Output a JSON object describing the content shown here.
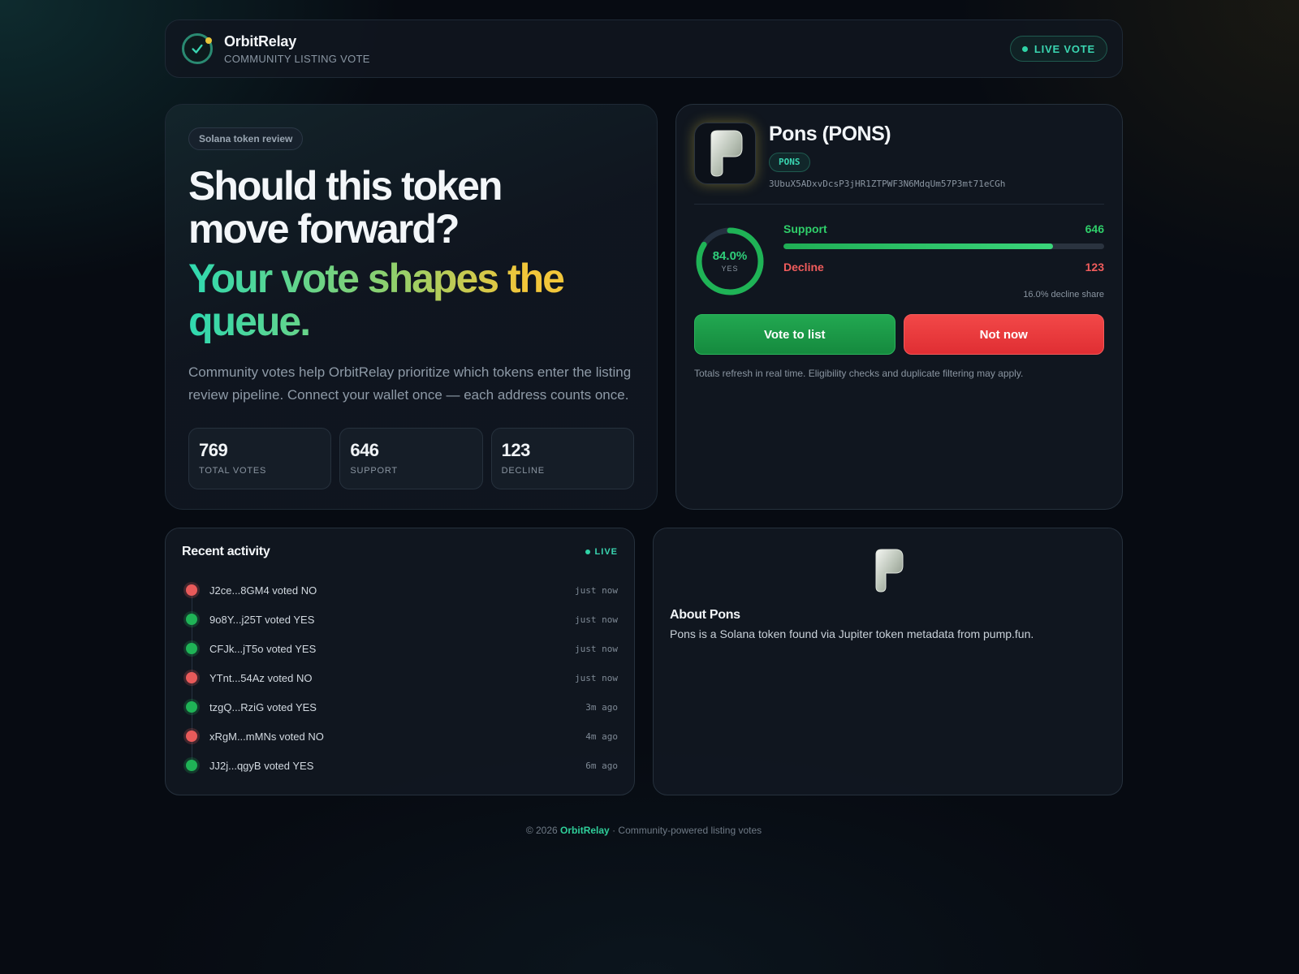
{
  "header": {
    "brand_name": "OrbitRelay",
    "brand_sub": "COMMUNITY LISTING VOTE",
    "live_label": "LIVE VOTE"
  },
  "hero": {
    "tag": "Solana token review",
    "headline_line1": "Should this token",
    "headline_line2": "move forward?",
    "highlight_line1": "Your vote shapes the",
    "highlight_line2": "queue.",
    "lead": "Community votes help OrbitRelay prioritize which tokens enter the listing review pipeline. Connect your wallet once — each address counts once.",
    "stats": [
      {
        "value": "769",
        "label": "TOTAL VOTES"
      },
      {
        "value": "646",
        "label": "SUPPORT"
      },
      {
        "value": "123",
        "label": "DECLINE"
      }
    ]
  },
  "token": {
    "name": "Pons (PONS)",
    "symbol": "PONS",
    "address": "3UbuX5ADxvDcsP3jHR1ZTPWF3N6MdqUm57P3mt71eCGh",
    "yes_pct_label": "84.0%",
    "yes_pct": 0.84,
    "yes_label": "YES",
    "support_label": "Support",
    "support_count": "646",
    "decline_label": "Decline",
    "decline_count": "123",
    "decline_share": "16.0% decline share",
    "vote_yes_label": "Vote to list",
    "vote_no_label": "Not now",
    "note": "Totals refresh in real time. Eligibility checks and duplicate filtering may apply."
  },
  "activity": {
    "title": "Recent activity",
    "live_label": "LIVE",
    "items": [
      {
        "text": "J2ce...8GM4 voted NO",
        "time": "just now",
        "vote": "no"
      },
      {
        "text": "9o8Y...j25T voted YES",
        "time": "just now",
        "vote": "yes"
      },
      {
        "text": "CFJk...jT5o voted YES",
        "time": "just now",
        "vote": "yes"
      },
      {
        "text": "YTnt...54Az voted NO",
        "time": "just now",
        "vote": "no"
      },
      {
        "text": "tzgQ...RziG voted YES",
        "time": "3m ago",
        "vote": "yes"
      },
      {
        "text": "xRgM...mMNs voted NO",
        "time": "4m ago",
        "vote": "no"
      },
      {
        "text": "JJ2j...qgyB voted YES",
        "time": "6m ago",
        "vote": "yes"
      }
    ]
  },
  "about": {
    "title": "About Pons",
    "text": "Pons is a Solana token found via Jupiter token metadata from pump.fun."
  },
  "footer": {
    "prefix": "© 2026",
    "brand": "OrbitRelay",
    "suffix": "· Community-powered listing votes"
  },
  "colors": {
    "accent": "#2fd3a6",
    "support": "#2fcf6a",
    "decline": "#f05c5c",
    "highlight_gold": "#f2c63a"
  },
  "icons": {
    "logo": "check-orbit-icon",
    "token": "pons-token-icon"
  }
}
